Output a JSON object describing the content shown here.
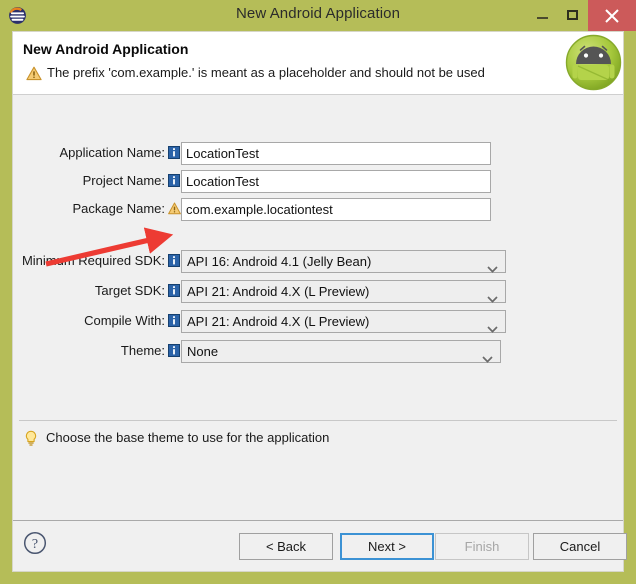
{
  "window": {
    "title": "New Android Application",
    "icon": "eclipse-icon",
    "controls": {
      "minimize": "minimize-button",
      "maximize": "maximize-button",
      "close": "close-button"
    },
    "titlebar_color": "#b5bd58",
    "close_color": "#cc5a5a"
  },
  "header": {
    "title": "New Android Application",
    "message": "The prefix 'com.example.' is meant as a placeholder and should not be used",
    "message_icon": "warning-icon",
    "badge_icon": "android-robot-icon"
  },
  "form": {
    "fields": [
      {
        "label": "Application Name:",
        "icon": "info-icon",
        "type": "text",
        "value": "LocationTest",
        "name": "application-name"
      },
      {
        "label": "Project Name:",
        "icon": "info-icon",
        "type": "text",
        "value": "LocationTest",
        "name": "project-name"
      },
      {
        "label": "Package Name:",
        "icon": "warning-icon",
        "type": "text",
        "value": "com.example.locationtest",
        "name": "package-name"
      },
      {
        "label": "Minimum Required SDK:",
        "icon": "info-icon",
        "type": "combo",
        "value": "API 16: Android 4.1 (Jelly Bean)",
        "name": "minimum-required-sdk"
      },
      {
        "label": "Target SDK:",
        "icon": "info-icon",
        "type": "combo",
        "value": "API 21: Android 4.X (L Preview)",
        "name": "target-sdk"
      },
      {
        "label": "Compile With:",
        "icon": "info-icon",
        "type": "combo",
        "value": "API 21: Android 4.X (L Preview)",
        "name": "compile-with"
      },
      {
        "label": "Theme:",
        "icon": "info-icon",
        "type": "combo",
        "value": "None",
        "name": "theme"
      }
    ]
  },
  "hint": {
    "icon": "lightbulb-icon",
    "text": "Choose the base theme to use for the application"
  },
  "footer": {
    "help_icon": "help-question-icon",
    "buttons": [
      {
        "label": "< Back",
        "name": "back-button",
        "state": "enabled"
      },
      {
        "label": "Next >",
        "name": "next-button",
        "state": "focused"
      },
      {
        "label": "Finish",
        "name": "finish-button",
        "state": "disabled"
      },
      {
        "label": "Cancel",
        "name": "cancel-button",
        "state": "enabled"
      }
    ]
  },
  "annotation": {
    "type": "red-arrow",
    "color": "#ed3b33",
    "points_to": "minimum-required-sdk"
  }
}
